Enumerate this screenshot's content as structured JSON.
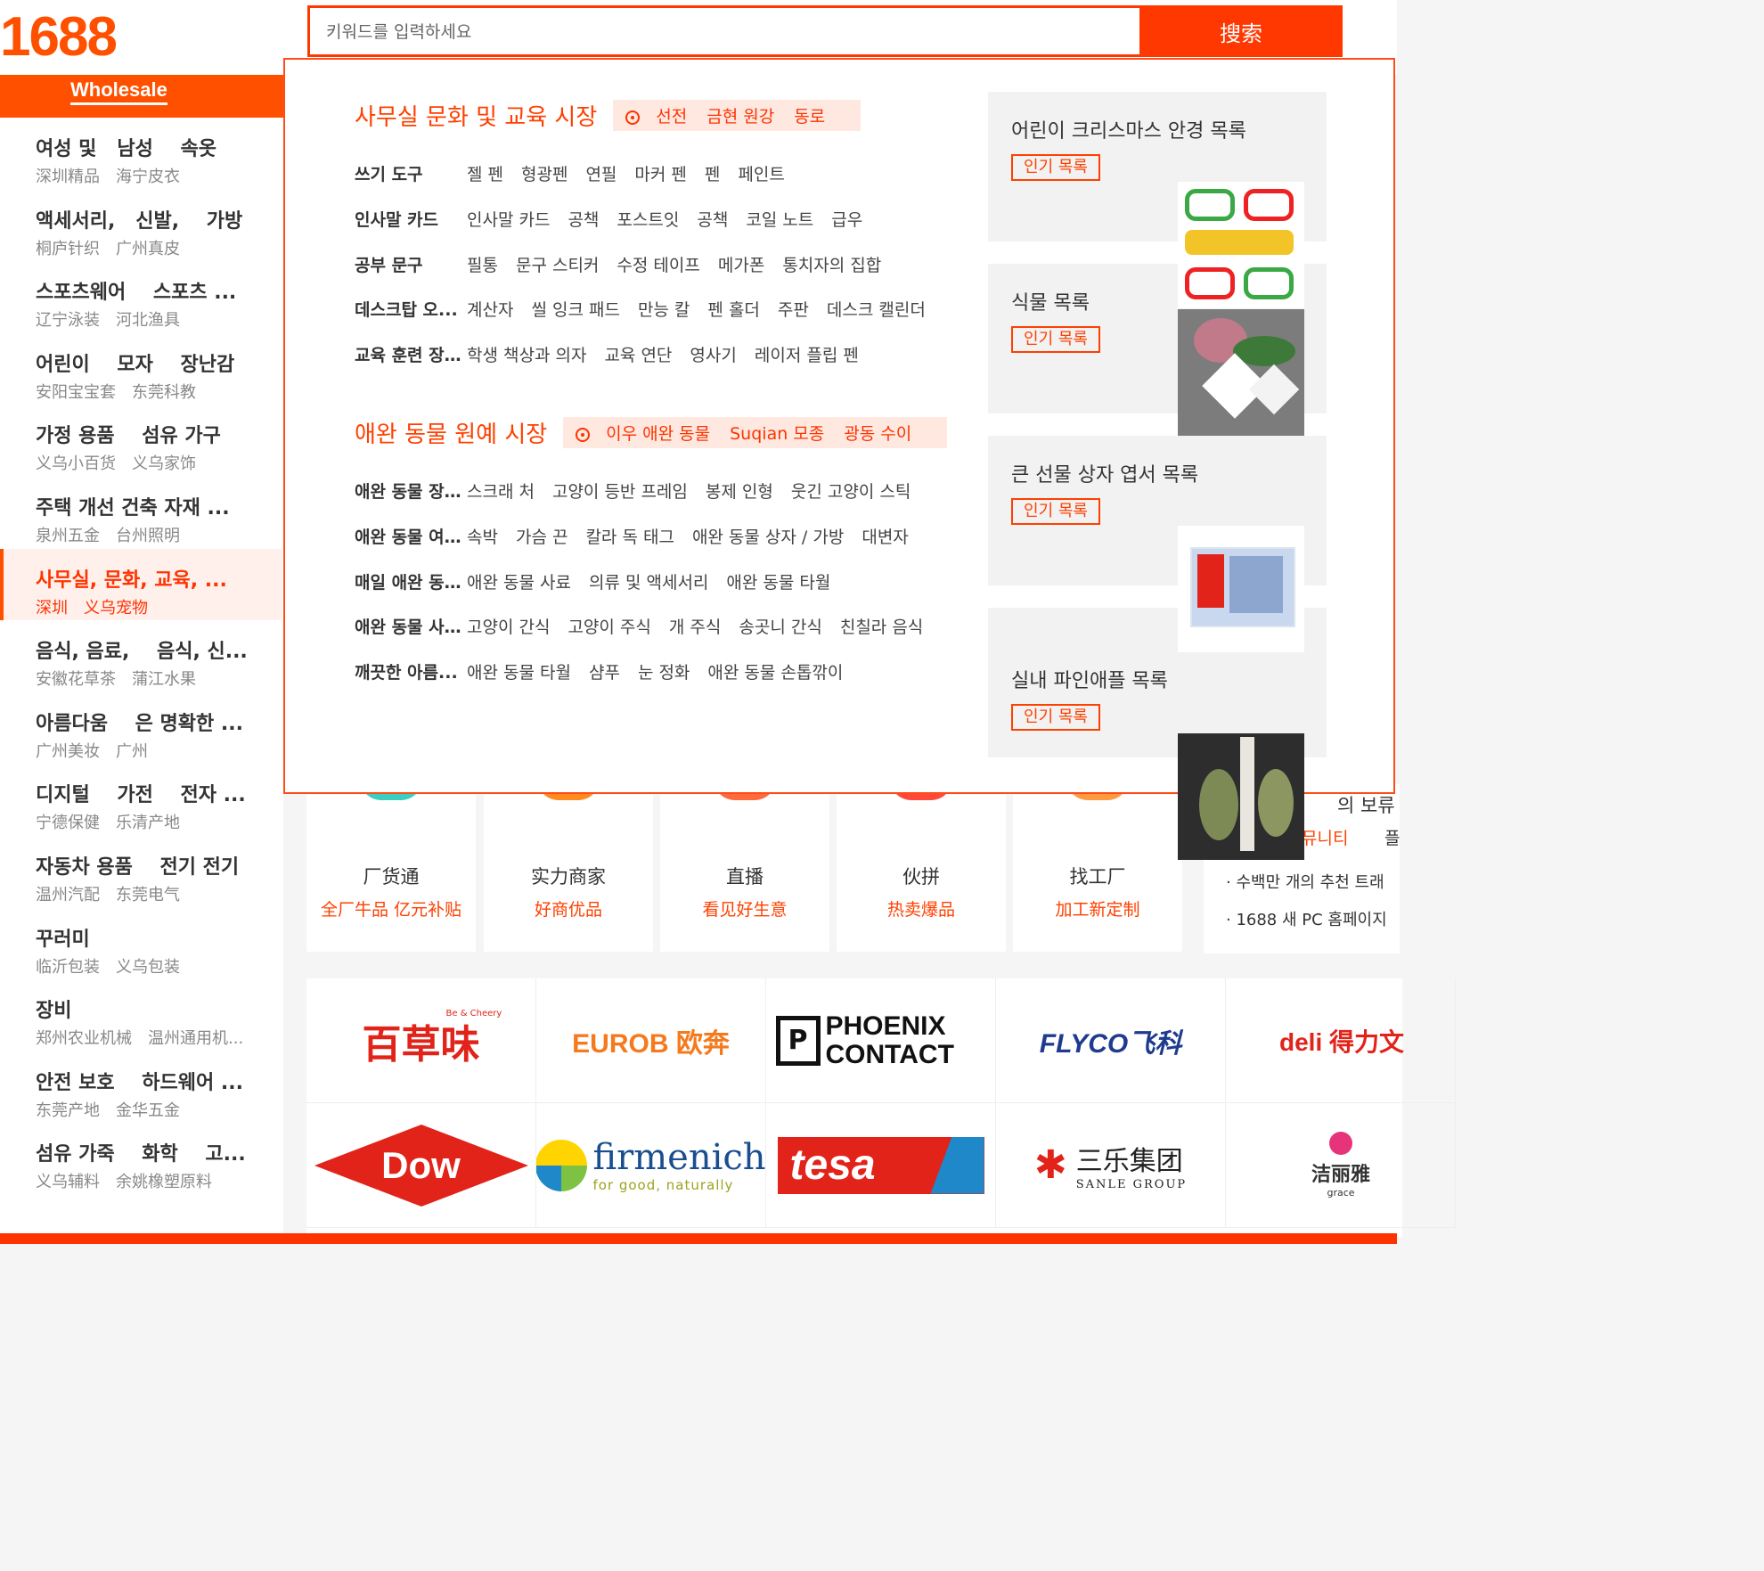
{
  "header": {
    "logo": "1688",
    "search_placeholder": "키워드를 입력하세요",
    "search_button": "搜索"
  },
  "sidebar": {
    "tab": "Wholesale",
    "items": [
      {
        "title": "여성 및   남성    속옷",
        "sub": [
          "深圳精品",
          "海宁皮衣"
        ]
      },
      {
        "title": "액세서리,   신발,    가방",
        "sub": [
          "桐庐针织",
          "广州真皮"
        ]
      },
      {
        "title": "스포츠웨어    스포츠 ...",
        "sub": [
          "辽宁泳装",
          "河北渔具"
        ]
      },
      {
        "title": "어린이    모자    장난감",
        "sub": [
          "安阳宝宝套",
          "东莞科教"
        ]
      },
      {
        "title": "가정 용품    섬유 가구",
        "sub": [
          "义乌小百货",
          "义乌家饰"
        ]
      },
      {
        "title": "주택 개선 건축 자재 ...",
        "sub": [
          "泉州五金",
          "台州照明"
        ]
      },
      {
        "title": "사무실, 문화, 교육, ...",
        "sub": [
          "深圳",
          "义乌宠物"
        ]
      },
      {
        "title": "음식, 음료,    음식, 신...",
        "sub": [
          "安徽花草茶",
          "蒲江水果"
        ]
      },
      {
        "title": "아름다움    은 명확한 ...",
        "sub": [
          "广州美妆",
          "广州"
        ]
      },
      {
        "title": "디지털    가전    전자 ...",
        "sub": [
          "宁德保健",
          "乐清产地"
        ]
      },
      {
        "title": "자동차 용품    전기 전기",
        "sub": [
          "温州汽配",
          "东莞电气"
        ]
      },
      {
        "title": "꾸러미",
        "sub": [
          "临沂包装",
          "义乌包装"
        ]
      },
      {
        "title": "장비",
        "sub": [
          "郑州农业机械",
          "温州通用机..."
        ]
      },
      {
        "title": "안전 보호    하드웨어 ...",
        "sub": [
          "东莞产地",
          "金华五金"
        ]
      },
      {
        "title": "섬유 가죽    화학    고...",
        "sub": [
          "义乌辅料",
          "余姚橡塑原料"
        ]
      }
    ]
  },
  "dropdown": {
    "sections": [
      {
        "title": "사무실 문화 및 교육 시장",
        "markets": [
          "선전",
          "금현 원강",
          "동로"
        ],
        "rows": [
          {
            "label": "쓰기 도구",
            "links": [
              "젤 펜",
              "형광펜",
              "연필",
              "마커 펜",
              "펜",
              "페인트"
            ]
          },
          {
            "label": "인사말 카드",
            "links": [
              "인사말 카드",
              "공책",
              "포스트잇",
              "공책",
              "코일 노트",
              "급우"
            ]
          },
          {
            "label": "공부 문구",
            "links": [
              "필통",
              "문구 스티커",
              "수정 테이프",
              "메가폰",
              "통치자의 집합"
            ]
          },
          {
            "label": "데스크탑 오...",
            "links": [
              "계산자",
              "씰 잉크 패드",
              "만능 칼",
              "펜 홀더",
              "주판",
              "데스크 캘린더"
            ]
          },
          {
            "label": "교육 훈련 장...",
            "links": [
              "학생 책상과 의자",
              "교육 연단",
              "영사기",
              "레이저 플립 펜"
            ]
          }
        ]
      },
      {
        "title": "애완 동물 원예 시장",
        "markets": [
          "이우 애완 동물",
          "Suqian 모종",
          "광동 수이"
        ],
        "rows": [
          {
            "label": "애완 동물 장...",
            "links": [
              "스크래 처",
              "고양이 등반 프레임",
              "봉제 인형",
              "웃긴 고양이 스틱"
            ]
          },
          {
            "label": "애완 동물 여...",
            "links": [
              "속박",
              "가슴 끈",
              "칼라 독 태그",
              "애완 동물 상자 / 가방",
              "대변자"
            ]
          },
          {
            "label": "매일 애완 동...",
            "links": [
              "애완 동물 사료",
              "의류 및 액세서리",
              "애완 동물 타월"
            ]
          },
          {
            "label": "애완 동물 사...",
            "links": [
              "고양이 간식",
              "고양이 주식",
              "개 주식",
              "송곳니 간식",
              "친칠라 음식"
            ]
          },
          {
            "label": "깨끗한 아름...",
            "links": [
              "애완 동물 타월",
              "샴푸",
              "눈 정화",
              "애완 동물 손톱깎이"
            ]
          }
        ]
      }
    ],
    "promos": [
      {
        "title": "어린이 크리스마스 안경 목록",
        "button": "인기 목록"
      },
      {
        "title": "식물 목록",
        "button": "인기 목록"
      },
      {
        "title": "큰 선물 상자 엽서 목록",
        "button": "인기 목록"
      },
      {
        "title": "실내 파인애플 목록",
        "button": "인기 목록"
      }
    ]
  },
  "features": [
    {
      "title": "厂货通",
      "sub": "全厂牛品 亿元补贴",
      "color": "#3ccfc0"
    },
    {
      "title": "实力商家",
      "sub": "好商优品",
      "color": "#ff8a1f"
    },
    {
      "title": "直播",
      "sub": "看见好生意",
      "color": "#ff6a3d"
    },
    {
      "title": "伙拼",
      "sub": "热卖爆品",
      "color": "#ff4a3a"
    },
    {
      "title": "找工厂",
      "sub": "加工新定制",
      "color": "#ff9a40"
    }
  ],
  "news": {
    "head": "의 보류",
    "community": "뮤니티",
    "community_b": "플",
    "lines": [
      "· 수백만 개의 추천 트래",
      "· 1688 새 PC 홈페이지"
    ]
  },
  "brands": {
    "row1": [
      "百草味",
      "EUROB 欧奔",
      "PHOENIX CONTACT",
      "FLYCO飞科",
      "deli 得力文"
    ],
    "row1_small": [
      "Be & Cheery",
      "",
      "",
      "",
      ""
    ],
    "row2": [
      "Dow",
      "firmenich",
      "tesa",
      "三乐集团",
      "洁丽雅"
    ],
    "row2_small": [
      "",
      "for good, naturally",
      "",
      "SANLE GROUP",
      "grace"
    ]
  },
  "colors": {
    "accent": "#ff5000",
    "search": "#ff3700"
  }
}
